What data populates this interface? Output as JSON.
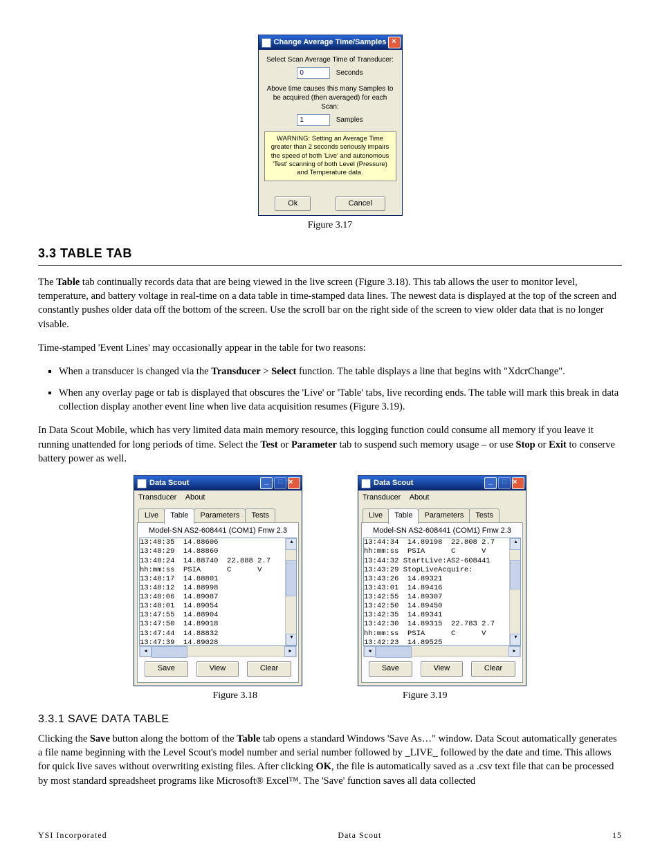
{
  "dlg317": {
    "title": "Change Average Time/Samples",
    "line1": "Select Scan Average Time of Transducer:",
    "secVal": "0",
    "secLabel": "Seconds",
    "line2": "Above time causes this many Samples to be acquired (then averaged) for each Scan:",
    "sampVal": "1",
    "sampLabel": "Samples",
    "warn": "WARNING: Setting an Average Time greater than 2 seconds seriously impairs the speed of both 'Live' and autonomous 'Test' scanning of both Level (Pressure) and Temperature data.",
    "ok": "Ok",
    "cancel": "Cancel",
    "caption": "Figure 3.17"
  },
  "sec": {
    "h": "3.3 TABLE TAB"
  },
  "p1a": "The ",
  "p1b": "Table",
  "p1c": " tab continually records data that are being viewed in the live screen (Figure 3.18). This tab allows the user to monitor level, temperature, and battery voltage in real-time on a data table in time-stamped data lines. The newest data is displayed at the top of the screen and constantly pushes older data off the bottom of the screen. Use the scroll bar on the right side of the screen to view older data that is no longer visable.",
  "p2": "Time-stamped 'Event Lines' may occasionally appear in the table for two reasons:",
  "b1a": "When a transducer is changed via the ",
  "b1b": "Transducer",
  "b1c": " > ",
  "b1d": "Select",
  "b1e": " function. The table displays a line that begins with \"XdcrChange\".",
  "b2": "When any overlay page or tab is displayed that obscures the 'Live' or 'Table' tabs, live recording ends. The table will mark this break in data collection display another event line when live data acquisition resumes (Figure 3.19).",
  "p3a": "In Data Scout Mobile, which has very limited data main memory resource, this logging function could consume all memory if you leave it running unattended for long periods of time.  Select the ",
  "p3b": "Test",
  "p3c": " or ",
  "p3d": "Parameter",
  "p3e": " tab to suspend such memory usage – or use ",
  "p3f": "Stop",
  "p3g": " or ",
  "p3h": "Exit",
  "p3i": " to conserve battery power as well.",
  "ds": {
    "title": "Data Scout",
    "menu": {
      "a": "Transducer",
      "b": "About"
    },
    "tabs": {
      "live": "Live",
      "table": "Table",
      "params": "Parameters",
      "tests": "Tests"
    },
    "sub": "Model-SN AS2-608441 (COM1) Fmw 2.3",
    "btn": {
      "save": "Save",
      "view": "View",
      "clear": "Clear"
    }
  },
  "list18": "13:48:35  14.88606\n13:48:29  14.88860\n13:48:24  14.88740  22.888 2.7\nhh:mm:ss  PSIA      C      V\n13:48:17  14.88801\n13:48:12  14.88998\n13:48:06  14.89087\n13:48:01  14.89054\n13:47:55  14.88904\n13:47:50  14.89018\n13:47:44  14.88832\n13:47:39  14.89028",
  "list19": "13:44:34  14.89198  22.808 2.7\nhh:mm:ss  PSIA      C      V\n13:44:32 StartLive:AS2-608441\n13:43:29 StopLiveAcquire:\n13:43:26  14.89321\n13:43:01  14.89416\n13:42:55  14.89307\n13:42:50  14.89450\n13:42:35  14.89341\n13:42:30  14.89315  22.783 2.7\nhh:mm:ss  PSIA      C      V\n13:42:23  14.89525",
  "cap18": "Figure 3.18",
  "cap19": "Figure 3.19",
  "h331": "3.3.1 SAVE DATA TABLE",
  "p4a": "Clicking the ",
  "p4b": "Save",
  "p4c": " button along the bottom of the ",
  "p4d": "Table",
  "p4e": " tab opens a standard Windows 'Save As…\" window. Data Scout automatically generates a file name beginning with the Level Scout's model number and serial number followed by _LIVE_ followed by the date and time.  This allows for quick live saves without overwriting existing files. After clicking ",
  "p4f": "OK",
  "p4g": ", the file is automatically saved as a .csv text file that can be processed by most standard spreadsheet programs like Microsoft® Excel™.  The 'Save' function saves all data collected",
  "footer": {
    "l": "YSI Incorporated",
    "c": "Data Scout",
    "r": "15"
  }
}
